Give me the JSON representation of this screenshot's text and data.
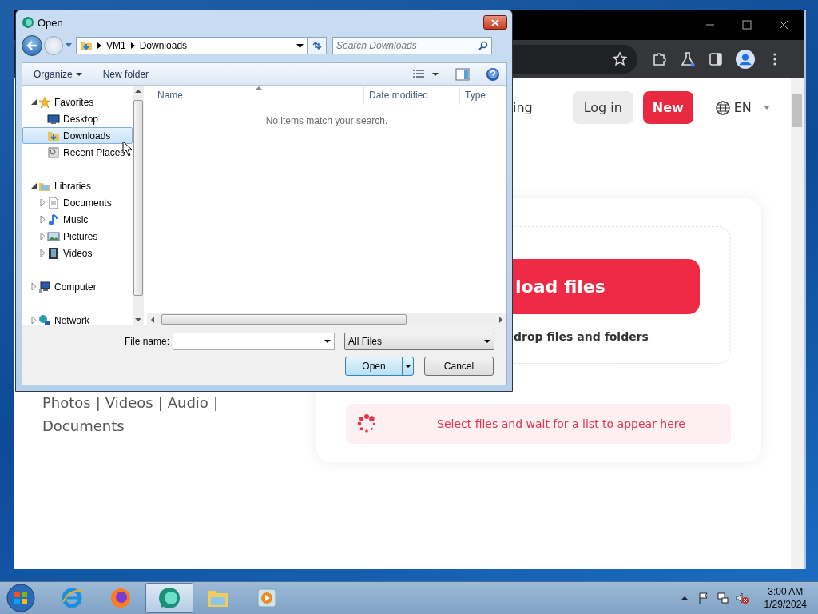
{
  "browser": {
    "header": {
      "nav_fragment": "ing",
      "login_button": "Log in",
      "new_button": "New",
      "language": "EN"
    },
    "side_links": [
      {
        "label": "Photos",
        "separator": "|"
      },
      {
        "label": "Videos",
        "separator": "|"
      },
      {
        "label": "Audio",
        "separator": "|"
      },
      {
        "label": "Documents"
      }
    ],
    "upload": {
      "button": "load files",
      "hint": "drop files and folders",
      "status": "Select files and wait for a list to appear here"
    }
  },
  "dialog": {
    "title": "Open",
    "path": [
      "VM1",
      "Downloads"
    ],
    "search_placeholder": "Search Downloads",
    "toolbar": [
      {
        "label": "Organize",
        "menu": true
      },
      {
        "label": "New folder",
        "menu": false
      }
    ],
    "nav_tree": [
      {
        "label": "Favorites",
        "kind": "favorites",
        "expanded": true,
        "selected": false,
        "children": [
          {
            "label": "Desktop",
            "kind": "desktop",
            "selected": false
          },
          {
            "label": "Downloads",
            "kind": "downloads",
            "selected": true
          },
          {
            "label": "Recent Places",
            "kind": "recent",
            "selected": false
          }
        ]
      },
      {
        "label": "Libraries",
        "kind": "libraries",
        "expanded": true,
        "selected": false,
        "children": [
          {
            "label": "Documents",
            "kind": "documents",
            "expanded": false,
            "selected": false
          },
          {
            "label": "Music",
            "kind": "music",
            "expanded": false,
            "selected": false
          },
          {
            "label": "Pictures",
            "kind": "pictures",
            "expanded": false,
            "selected": false
          },
          {
            "label": "Videos",
            "kind": "videos",
            "expanded": false,
            "selected": false
          }
        ]
      },
      {
        "label": "Computer",
        "kind": "computer",
        "expanded": false,
        "selected": false
      },
      {
        "label": "Network",
        "kind": "network",
        "expanded": false,
        "selected": false
      }
    ],
    "columns": [
      "Name",
      "Date modified",
      "Type"
    ],
    "empty_message": "No items match your search.",
    "file_name_label": "File name:",
    "filter": "All Files",
    "buttons": [
      "Open",
      "Cancel"
    ]
  },
  "taskbar": {
    "apps": [
      {
        "kind": "ie",
        "active": false
      },
      {
        "kind": "firefox",
        "active": false
      },
      {
        "kind": "app",
        "active": true
      },
      {
        "kind": "explorer",
        "active": false
      },
      {
        "kind": "media",
        "active": false
      }
    ],
    "clock": {
      "time": "3:00 AM",
      "date": "1/29/2024"
    }
  }
}
